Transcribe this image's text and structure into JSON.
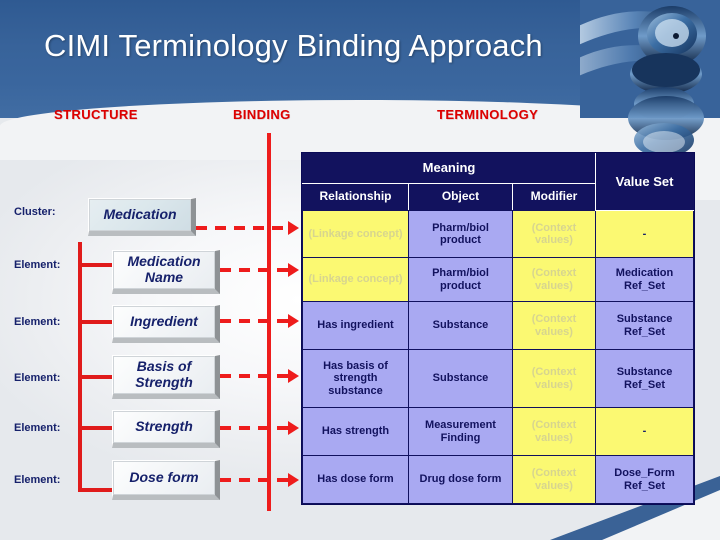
{
  "slide": {
    "title": "CIMI Terminology Binding Approach",
    "captions": {
      "structure": "STRUCTURE",
      "binding": "BINDING",
      "terminology": "TERMINOLOGY"
    },
    "accent_red": "#dd0000",
    "banner_blue": "#38639a",
    "navy": "#12125e",
    "yellow_cell": "#fbf972",
    "purple_cell": "#a9a9f2"
  },
  "structure": {
    "nodes": [
      {
        "kind": "Cluster:",
        "label": "Medication"
      },
      {
        "kind": "Element:",
        "label": "Medication Name"
      },
      {
        "kind": "Element:",
        "label": "Ingredient"
      },
      {
        "kind": "Element:",
        "label": "Basis of Strength"
      },
      {
        "kind": "Element:",
        "label": "Strength"
      },
      {
        "kind": "Element:",
        "label": "Dose form"
      }
    ]
  },
  "terminology_table": {
    "group_header": "Meaning",
    "value_set_header": "Value Set",
    "columns": [
      "Relationship",
      "Object",
      "Modifier",
      "Value Set"
    ],
    "rows": [
      {
        "relationship": {
          "text": "(Linkage concept)",
          "fill": "yellow",
          "muted": true
        },
        "object": {
          "text": "Pharm/biol product",
          "fill": "purple",
          "muted": false
        },
        "modifier": {
          "text": "(Context values)",
          "fill": "yellow",
          "muted": true
        },
        "value_set": {
          "text": "-",
          "fill": "yellow",
          "muted": false
        }
      },
      {
        "relationship": {
          "text": "(Linkage concept)",
          "fill": "yellow",
          "muted": true
        },
        "object": {
          "text": "Pharm/biol product",
          "fill": "purple",
          "muted": false
        },
        "modifier": {
          "text": "(Context values)",
          "fill": "yellow",
          "muted": true
        },
        "value_set": {
          "text": "Medication Ref_Set",
          "fill": "purple",
          "muted": false
        }
      },
      {
        "relationship": {
          "text": "Has ingredient",
          "fill": "purple",
          "muted": false
        },
        "object": {
          "text": "Substance",
          "fill": "purple",
          "muted": false
        },
        "modifier": {
          "text": "(Context values)",
          "fill": "yellow",
          "muted": true
        },
        "value_set": {
          "text": "Substance Ref_Set",
          "fill": "purple",
          "muted": false
        }
      },
      {
        "relationship": {
          "text": "Has basis of strength substance",
          "fill": "purple",
          "muted": false
        },
        "object": {
          "text": "Substance",
          "fill": "purple",
          "muted": false
        },
        "modifier": {
          "text": "(Context values)",
          "fill": "yellow",
          "muted": true
        },
        "value_set": {
          "text": "Substance Ref_Set",
          "fill": "purple",
          "muted": false
        }
      },
      {
        "relationship": {
          "text": "Has strength",
          "fill": "purple",
          "muted": false
        },
        "object": {
          "text": "Measurement Finding",
          "fill": "purple",
          "muted": false
        },
        "modifier": {
          "text": "(Context values)",
          "fill": "yellow",
          "muted": true
        },
        "value_set": {
          "text": "-",
          "fill": "yellow",
          "muted": false
        }
      },
      {
        "relationship": {
          "text": "Has dose form",
          "fill": "purple",
          "muted": false
        },
        "object": {
          "text": "Drug dose form",
          "fill": "purple",
          "muted": false
        },
        "modifier": {
          "text": "(Context values)",
          "fill": "yellow",
          "muted": true
        },
        "value_set": {
          "text": "Dose_Form Ref_Set",
          "fill": "purple",
          "muted": false
        }
      }
    ]
  },
  "decor": {
    "stethoscope": "stethoscope-image"
  }
}
